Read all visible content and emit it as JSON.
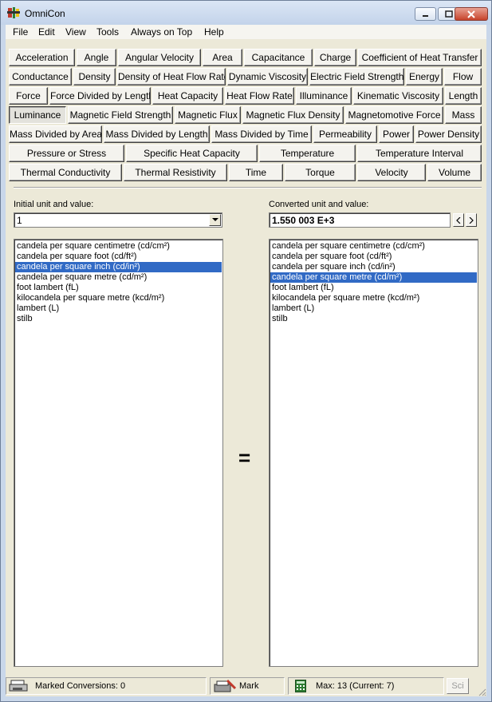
{
  "window": {
    "title": "OmniCon"
  },
  "menu": [
    "File",
    "Edit",
    "View",
    "Tools",
    "Always on Top",
    "Help"
  ],
  "categories": {
    "row1": [
      "Acceleration",
      "Angle",
      "Angular Velocity",
      "Area",
      "Capacitance",
      "Charge",
      "Coefficient of Heat Transfer"
    ],
    "row2": [
      "Conductance",
      "Density",
      "Density of Heat Flow Rate",
      "Dynamic Viscosity",
      "Electric Field Strength",
      "Energy",
      "Flow"
    ],
    "row3": [
      "Force",
      "Force Divided by Length",
      "Heat Capacity",
      "Heat Flow Rate",
      "Illuminance",
      "Kinematic Viscosity",
      "Length"
    ],
    "row4": [
      "Luminance",
      "Magnetic Field Strength",
      "Magnetic Flux",
      "Magnetic Flux Density",
      "Magnetomotive Force",
      "Mass"
    ],
    "row5": [
      "Mass Divided by Area",
      "Mass Divided by Length",
      "Mass Divided by Time",
      "Permeability",
      "Power",
      "Power Density"
    ],
    "row6": [
      "Pressure or Stress",
      "Specific Heat Capacity",
      "Temperature",
      "Temperature Interval"
    ],
    "row7": [
      "Thermal Conductivity",
      "Thermal Resistivity",
      "Time",
      "Torque",
      "Velocity",
      "Volume"
    ],
    "active": "Luminance"
  },
  "initial": {
    "label": "Initial unit and value:",
    "value": "1",
    "units": [
      "candela per square centimetre (cd/cm²)",
      "candela per square foot (cd/ft²)",
      "candela per square inch (cd/in²)",
      "candela per square metre (cd/m²)",
      "foot lambert (fL)",
      "kilocandela per square metre (kcd/m²)",
      "lambert (L)",
      "stilb"
    ],
    "selected_index": 2
  },
  "converted": {
    "label": "Converted unit and value:",
    "value": "1.550 003 E+3",
    "prev_label": "<",
    "next_label": ">",
    "units": [
      "candela per square centimetre (cd/cm²)",
      "candela per square foot (cd/ft²)",
      "candela per square inch (cd/in²)",
      "candela per square metre (cd/m²)",
      "foot lambert (fL)",
      "kilocandela per square metre (kcd/m²)",
      "lambert (L)",
      "stilb"
    ],
    "selected_index": 3
  },
  "equals_sign": "=",
  "status": {
    "marked": "Marked Conversions: 0",
    "mark_label": "Mark",
    "max": "Max: 13 (Current: 7)",
    "sci_label": "Sci"
  },
  "colors": {
    "selection": "#316ac5",
    "face": "#ece9d8"
  }
}
